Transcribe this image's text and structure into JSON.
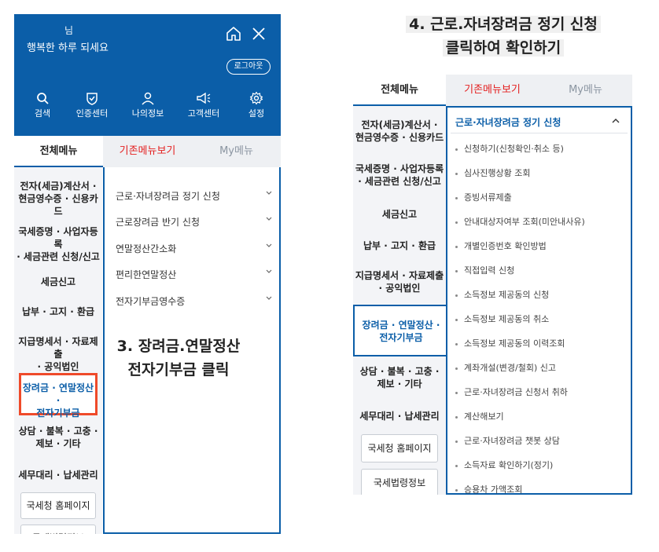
{
  "header": {
    "greeting_name": "님",
    "greeting_msg": "행복한 하루 되세요",
    "logout_label": "로그아웃",
    "home_icon": "home-icon",
    "close_icon": "close-icon",
    "quick_menu": [
      {
        "label": "검색",
        "icon": "search-icon"
      },
      {
        "label": "인증센터",
        "icon": "shield-check-icon"
      },
      {
        "label": "나의정보",
        "icon": "person-icon"
      },
      {
        "label": "고객센터",
        "icon": "megaphone-icon"
      },
      {
        "label": "설정",
        "icon": "gear-icon"
      }
    ],
    "bg_color": "#0b5ea8"
  },
  "tabs": {
    "all": "전체메뉴",
    "old": "기존메뉴보기",
    "my": "My메뉴"
  },
  "left": {
    "side": {
      "item1": "전자(세금)계산서 ·",
      "item1b": "현금영수증 · 신용카드",
      "item2": "국세증명 · 사업자등록",
      "item2b": "· 세금관련 신청/신고",
      "item3": "세금신고",
      "item4": "납부 · 고지 · 환급",
      "item5": "지급명세서 · 자료제출",
      "item5b": "· 공익법인",
      "item6": "장려금 · 연말정산 ·",
      "item6b": "전자기부금",
      "item7": "상담 · 불복 · 고충 ·",
      "item7b": "제보 · 기타",
      "item8": "세무대리 · 납세관리",
      "btn1": "국세청 홈페이지",
      "btn2": "국세법령정보"
    },
    "submenu": [
      "근로·자녀장려금 정기 신청",
      "근로장려금 반기 신청",
      "연말정산간소화",
      "편리한연말정산",
      "전자기부금영수증"
    ],
    "caption_line1": "3. 장려금.연말정산",
    "caption_line2": "전자기부금 클릭"
  },
  "right": {
    "caption_line1": "4. 근로.자녀장려금 정기 신청",
    "caption_line2": "클릭하여 확인하기",
    "side": {
      "item1": "전자(세금)계산서 ·",
      "item1b": "현금영수증 · 신용카드",
      "item2": "국세증명 · 사업자등록",
      "item2b": "· 세금관련 신청/신고",
      "item3": "세금신고",
      "item4": "납부 · 고지 · 환급",
      "item5": "지급명세서 · 자료제출",
      "item5b": "· 공익법인",
      "item6": "장려금 · 연말정산 ·",
      "item6b": "전자기부금",
      "item7": "상담 · 불복 · 고충 ·",
      "item7b": "제보 · 기타",
      "item8": "세무대리 · 납세관리",
      "btn1": "국세청 홈페이지",
      "btn2": "국세법령정보"
    },
    "expanded_title": "근로·자녀장려금 정기 신청",
    "leaves": [
      "신청하기(신청확인·취소 등)",
      "심사진행상황 조회",
      "증빙서류제출",
      "안내대상자여부 조회(미안내사유)",
      "개별인증번호 확인방법",
      "직접입력 신청",
      "소득정보 제공동의 신청",
      "소득정보 제공동의 취소",
      "소득정보 제공동의 이력조회",
      "계좌개설(변경/철회) 신고",
      "근로·자녀장려금 신청서 취하",
      "계산해보기",
      "근로·자녀장려금 챗봇 상담",
      "소득자료 확인하기(정기)",
      "승용차 가액조회"
    ]
  }
}
